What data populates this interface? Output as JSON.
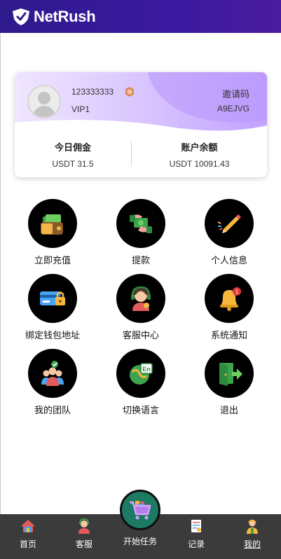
{
  "app": {
    "brand": "NetRush"
  },
  "colors": {
    "header": "#2e1a8c",
    "tabbar": "#3b3b3b",
    "fab": "#1d7a63",
    "card_gradient": "#c7a8ff"
  },
  "profile": {
    "phone": "123333333",
    "level": "VIP1",
    "invite_label": "邀请码",
    "invite_code": "A9EJVG"
  },
  "stats": {
    "commission_label": "今日佣金",
    "commission_value": "USDT 31.5",
    "balance_label": "账户余额",
    "balance_value": "USDT 10091.43"
  },
  "menu": [
    {
      "label": "立即充值",
      "icon": "wallet-icon"
    },
    {
      "label": "提款",
      "icon": "cash-withdraw-icon"
    },
    {
      "label": "个人信息",
      "icon": "pencil-icon"
    },
    {
      "label": "绑定钱包地址",
      "icon": "card-lock-icon"
    },
    {
      "label": "客服中心",
      "icon": "support-agent-icon"
    },
    {
      "label": "系统通知",
      "icon": "bell-icon"
    },
    {
      "label": "我的团队",
      "icon": "team-icon"
    },
    {
      "label": "切换语言",
      "icon": "language-icon"
    },
    {
      "label": "退出",
      "icon": "logout-icon"
    }
  ],
  "tabbar": {
    "items": [
      {
        "label": "首页",
        "icon": "home-icon"
      },
      {
        "label": "客服",
        "icon": "support-icon"
      },
      {
        "label": "开始任务",
        "icon": "cart-icon"
      },
      {
        "label": "记录",
        "icon": "record-icon"
      },
      {
        "label": "我的",
        "icon": "profile-icon",
        "active": true
      }
    ]
  }
}
